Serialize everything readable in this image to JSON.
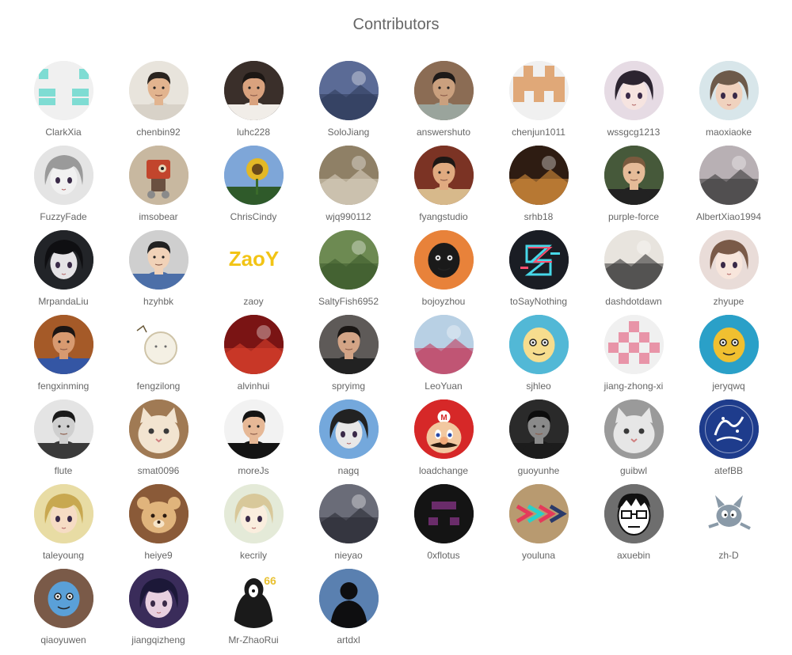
{
  "page": {
    "title": "Contributors"
  },
  "contributors": [
    {
      "name": "ClarkXia",
      "avatar": {
        "kind": "identicon",
        "bg": "#f0f0f0",
        "fg": "#7fdcd3",
        "pattern": "tealgrid"
      }
    },
    {
      "name": "chenbin92",
      "avatar": {
        "kind": "person",
        "bg": "#e8e4dc",
        "skin": "#e2b48f",
        "hair": "#2a241f",
        "shirt": "#d8d2c8"
      }
    },
    {
      "name": "luhc228",
      "avatar": {
        "kind": "person",
        "bg": "#3a2f2a",
        "skin": "#d9a27e",
        "hair": "#1c1714",
        "shirt": "#f1ede8"
      }
    },
    {
      "name": "SoloJiang",
      "avatar": {
        "kind": "scene",
        "bg": "#5b6b96",
        "accent": "#2f3b5a"
      }
    },
    {
      "name": "answershuto",
      "avatar": {
        "kind": "person",
        "bg": "#8b6c54",
        "skin": "#caa07e",
        "hair": "#1e1a18",
        "shirt": "#9aa49c"
      }
    },
    {
      "name": "chenjun1011",
      "avatar": {
        "kind": "identicon",
        "bg": "#f0f0f0",
        "fg": "#e0a878",
        "pattern": "tan"
      }
    },
    {
      "name": "wssgcg1213",
      "avatar": {
        "kind": "anime",
        "bg": "#e6dbe4",
        "hair": "#2c2430",
        "skin": "#f6e4e0"
      }
    },
    {
      "name": "maoxiaoke",
      "avatar": {
        "kind": "anime",
        "bg": "#d8e6ea",
        "hair": "#6d5a4a",
        "skin": "#f0d2be"
      }
    },
    {
      "name": "FuzzyFade",
      "avatar": {
        "kind": "anime",
        "bg": "#e4e4e4",
        "hair": "#9a9a9a",
        "skin": "#f1f1f1"
      }
    },
    {
      "name": "imsobear",
      "avatar": {
        "kind": "robot",
        "bg": "#c8b8a0",
        "accent": "#c2452c"
      }
    },
    {
      "name": "ChrisCindy",
      "avatar": {
        "kind": "flower",
        "bg": "#7ea6d8",
        "accent": "#e3b826"
      }
    },
    {
      "name": "wjq990112",
      "avatar": {
        "kind": "scene",
        "bg": "#8f8066",
        "accent": "#d9cfbe"
      }
    },
    {
      "name": "fyangstudio",
      "avatar": {
        "kind": "person",
        "bg": "#7b3324",
        "skin": "#e0aa80",
        "hair": "#1d1715",
        "shirt": "#d7b98b"
      }
    },
    {
      "name": "srhb18",
      "avatar": {
        "kind": "scene",
        "bg": "#2e1c12",
        "accent": "#d58d3a"
      }
    },
    {
      "name": "purple-force",
      "avatar": {
        "kind": "person",
        "bg": "#46593a",
        "skin": "#e5bb98",
        "hair": "#7a5a3e",
        "shirt": "#222222"
      }
    },
    {
      "name": "AlbertXiao1994",
      "avatar": {
        "kind": "scene",
        "bg": "#b8b0b4",
        "accent": "#3a3a3a"
      }
    },
    {
      "name": "MrpandaLiu",
      "avatar": {
        "kind": "anime",
        "bg": "#222428",
        "hair": "#0f0f12",
        "skin": "#e5e3e6"
      }
    },
    {
      "name": "hzyhbk",
      "avatar": {
        "kind": "person",
        "bg": "#cfcfcf",
        "skin": "#f1d2b8",
        "hair": "#222222",
        "shirt": "#4c6fa8"
      }
    },
    {
      "name": "zaoy",
      "avatar": {
        "kind": "logo",
        "bg": "#ffffff",
        "fg": "#f2c415",
        "text": "ZaoY"
      }
    },
    {
      "name": "SaltyFish6952",
      "avatar": {
        "kind": "scene",
        "bg": "#6d8a52",
        "accent": "#3c5a2c"
      }
    },
    {
      "name": "bojoyzhou",
      "avatar": {
        "kind": "cartoon",
        "bg": "#e8823a",
        "accent": "#1a1a1a"
      }
    },
    {
      "name": "toSayNothing",
      "avatar": {
        "kind": "glitch",
        "bg": "#1a1d24",
        "accent": "#ff4e6e",
        "accent2": "#47d8e8"
      }
    },
    {
      "name": "dashdotdawn",
      "avatar": {
        "kind": "scene",
        "bg": "#e8e4de",
        "accent": "#333333"
      }
    },
    {
      "name": "zhyupe",
      "avatar": {
        "kind": "anime",
        "bg": "#e9dcd8",
        "hair": "#7a5a48",
        "skin": "#f8e6dc"
      }
    },
    {
      "name": "fengxinming",
      "avatar": {
        "kind": "person",
        "bg": "#a55a28",
        "skin": "#d89a70",
        "hair": "#1c1614",
        "shirt": "#3456a4"
      }
    },
    {
      "name": "fengzilong",
      "avatar": {
        "kind": "sketch",
        "bg": "#ffffff",
        "accent": "#cfc4a8"
      }
    },
    {
      "name": "alvinhui",
      "avatar": {
        "kind": "scene",
        "bg": "#7a1414",
        "accent": "#d8402c"
      }
    },
    {
      "name": "spryimg",
      "avatar": {
        "kind": "person",
        "bg": "#5e5a58",
        "skin": "#d3a486",
        "hair": "#1a1614",
        "shirt": "#222222"
      }
    },
    {
      "name": "LeoYuan",
      "avatar": {
        "kind": "scene",
        "bg": "#b8d0e4",
        "accent": "#c23a5c"
      }
    },
    {
      "name": "sjhleo",
      "avatar": {
        "kind": "cartoon",
        "bg": "#52b8d6",
        "accent": "#f6dd8e"
      }
    },
    {
      "name": "jiang-zhong-xi",
      "avatar": {
        "kind": "identicon",
        "bg": "#f0f0f0",
        "fg": "#e894a8",
        "pattern": "pinkgrid"
      }
    },
    {
      "name": "jeryqwq",
      "avatar": {
        "kind": "cartoon",
        "bg": "#2aa0c8",
        "accent": "#f0c030"
      }
    },
    {
      "name": "flute",
      "avatar": {
        "kind": "person",
        "bg": "#e4e4e4",
        "skin": "#cfcfcf",
        "hair": "#1a1a1a",
        "shirt": "#3a3a3a"
      }
    },
    {
      "name": "smat0096",
      "avatar": {
        "kind": "cat",
        "bg": "#a07a54",
        "accent": "#f2e4d0"
      }
    },
    {
      "name": "moreJs",
      "avatar": {
        "kind": "person",
        "bg": "#f2f2f2",
        "skin": "#e6b896",
        "hair": "#141414",
        "shirt": "#141414"
      }
    },
    {
      "name": "nagq",
      "avatar": {
        "kind": "anime",
        "bg": "#74a8dc",
        "hair": "#222222",
        "skin": "#e8e8e8"
      }
    },
    {
      "name": "loadchange",
      "avatar": {
        "kind": "mario",
        "bg": "#d62828",
        "accent": "#f2c8a0"
      }
    },
    {
      "name": "guoyunhe",
      "avatar": {
        "kind": "person",
        "bg": "#2a2a2a",
        "skin": "#8a8a8a",
        "hair": "#0c0c0c",
        "shirt": "#1c1c1c"
      }
    },
    {
      "name": "guibwl",
      "avatar": {
        "kind": "cat",
        "bg": "#9a9a9a",
        "accent": "#e6e6e6"
      }
    },
    {
      "name": "atefBB",
      "avatar": {
        "kind": "calligraphy",
        "bg": "#1e3c8c",
        "accent": "#ffffff"
      }
    },
    {
      "name": "taleyoung",
      "avatar": {
        "kind": "anime",
        "bg": "#e8dca4",
        "hair": "#c8a850",
        "skin": "#f6dcc4"
      }
    },
    {
      "name": "heiye9",
      "avatar": {
        "kind": "bear",
        "bg": "#8a5a38",
        "accent": "#e0b47c"
      }
    },
    {
      "name": "kecrily",
      "avatar": {
        "kind": "anime",
        "bg": "#e4ead8",
        "hair": "#d8c89a",
        "skin": "#faeede"
      }
    },
    {
      "name": "nieyao",
      "avatar": {
        "kind": "scene",
        "bg": "#6a6c78",
        "accent": "#2a2c34"
      }
    },
    {
      "name": "0xflotus",
      "avatar": {
        "kind": "identicon",
        "bg": "#141414",
        "fg": "#6a2c6a",
        "pattern": "purple"
      }
    },
    {
      "name": "youluna",
      "avatar": {
        "kind": "arrows",
        "bg": "#b89a70",
        "accent": "#e43a5a",
        "accent2": "#2ad0c8"
      }
    },
    {
      "name": "axuebin",
      "avatar": {
        "kind": "cartoonface",
        "bg": "#6e6e6e",
        "accent": "#ffffff"
      }
    },
    {
      "name": "zh-D",
      "avatar": {
        "kind": "tomcat",
        "bg": "#ffffff",
        "accent": "#8a9aa8"
      }
    },
    {
      "name": "qiaoyuwen",
      "avatar": {
        "kind": "cartoon",
        "bg": "#7a5a48",
        "accent": "#5aa0d8"
      }
    },
    {
      "name": "jiangqizheng",
      "avatar": {
        "kind": "anime",
        "bg": "#3a2c5a",
        "hair": "#1c1838",
        "skin": "#e8d0e0"
      }
    },
    {
      "name": "Mr-ZhaoRui",
      "avatar": {
        "kind": "meme",
        "bg": "#ffffff",
        "accent": "#1a1a1a"
      }
    },
    {
      "name": "artdxl",
      "avatar": {
        "kind": "silhouette",
        "bg": "#5a80b0",
        "accent": "#0e0e10"
      }
    }
  ]
}
